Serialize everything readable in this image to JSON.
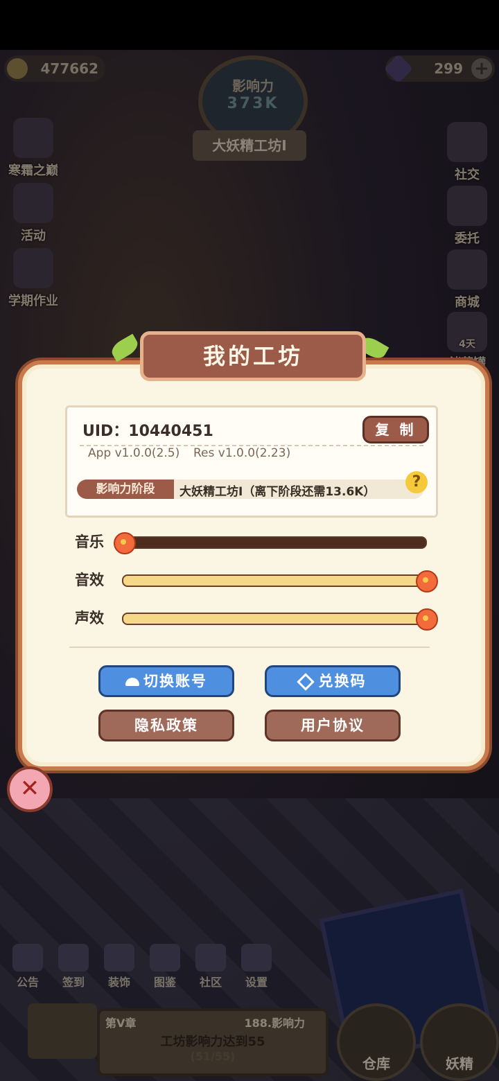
{
  "hud": {
    "coins": "477662",
    "gems": "299",
    "influence_label": "影响力",
    "influence_value": "373K",
    "stage_banner": "大妖精工坊Ⅰ"
  },
  "side_left": [
    {
      "label": "寒霜之巅"
    },
    {
      "label": "活动"
    },
    {
      "label": "学期作业"
    }
  ],
  "side_right": [
    {
      "label": "社交"
    },
    {
      "label": "委托"
    },
    {
      "label": "商城"
    },
    {
      "label": "储蓄罐",
      "badge": "4天"
    }
  ],
  "dialog": {
    "title": "我的工坊",
    "uid": "UID：10440451",
    "copy_label": "复 制",
    "app_version": "App v1.0.0(2.5)",
    "res_version": "Res v1.0.0(2.23)",
    "stage_label": "影响力阶段",
    "stage_text": "大妖精工坊Ⅰ（离下阶段还需13.6K）",
    "sliders": [
      {
        "label": "音乐",
        "level": 0.0
      },
      {
        "label": "音效",
        "level": 1.0
      },
      {
        "label": "声效",
        "level": 1.0
      }
    ],
    "buttons": {
      "switch_account": "切换账号",
      "redeem_code": "兑换码",
      "privacy": "隐私政策",
      "agreement": "用户协议"
    }
  },
  "bottom_nav": [
    {
      "label": "公告"
    },
    {
      "label": "签到"
    },
    {
      "label": "装饰"
    },
    {
      "label": "图鉴"
    },
    {
      "label": "社区"
    },
    {
      "label": "设置"
    }
  ],
  "quest": {
    "chapter": "第V章",
    "points": "188.影响力",
    "goal": "工坊影响力达到55",
    "progress": "(51/55)"
  },
  "corner": {
    "warehouse": "仓库",
    "fairy": "妖精"
  },
  "colors": {
    "accent_blue": "#4e8fe0",
    "accent_brown": "#9c5b49",
    "panel": "#fbf5e4"
  }
}
